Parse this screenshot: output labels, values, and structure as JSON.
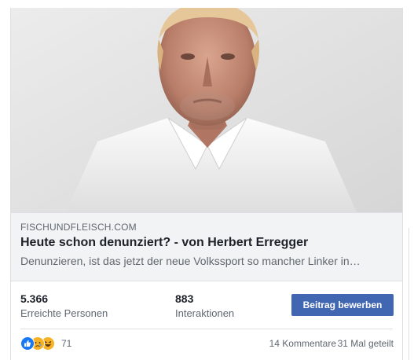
{
  "post": {
    "link_preview": {
      "domain": "FISCHUNDFLEISCH.COM",
      "title": "Heute schon denunziert? - von Herbert Erregger",
      "description": "Denunzieren, ist das jetzt der neue Volkssport so mancher Linker in…"
    },
    "stats": {
      "reach_value": "5.366",
      "reach_label": "Erreichte Personen",
      "engagement_value": "883",
      "engagement_label": "Interaktionen",
      "promote_label": "Beitrag bewerben"
    },
    "footer": {
      "reaction_icons": [
        "like-icon",
        "sad-icon",
        "haha-icon"
      ],
      "reaction_count": "71",
      "comments": "14 Kommentare",
      "shares": "31 Mal geteilt"
    }
  },
  "colors": {
    "primary_button": "#4267b2",
    "link_box_bg": "#f2f3f5",
    "like": "#1877f2",
    "reaction_yellow": "#f7b125"
  }
}
